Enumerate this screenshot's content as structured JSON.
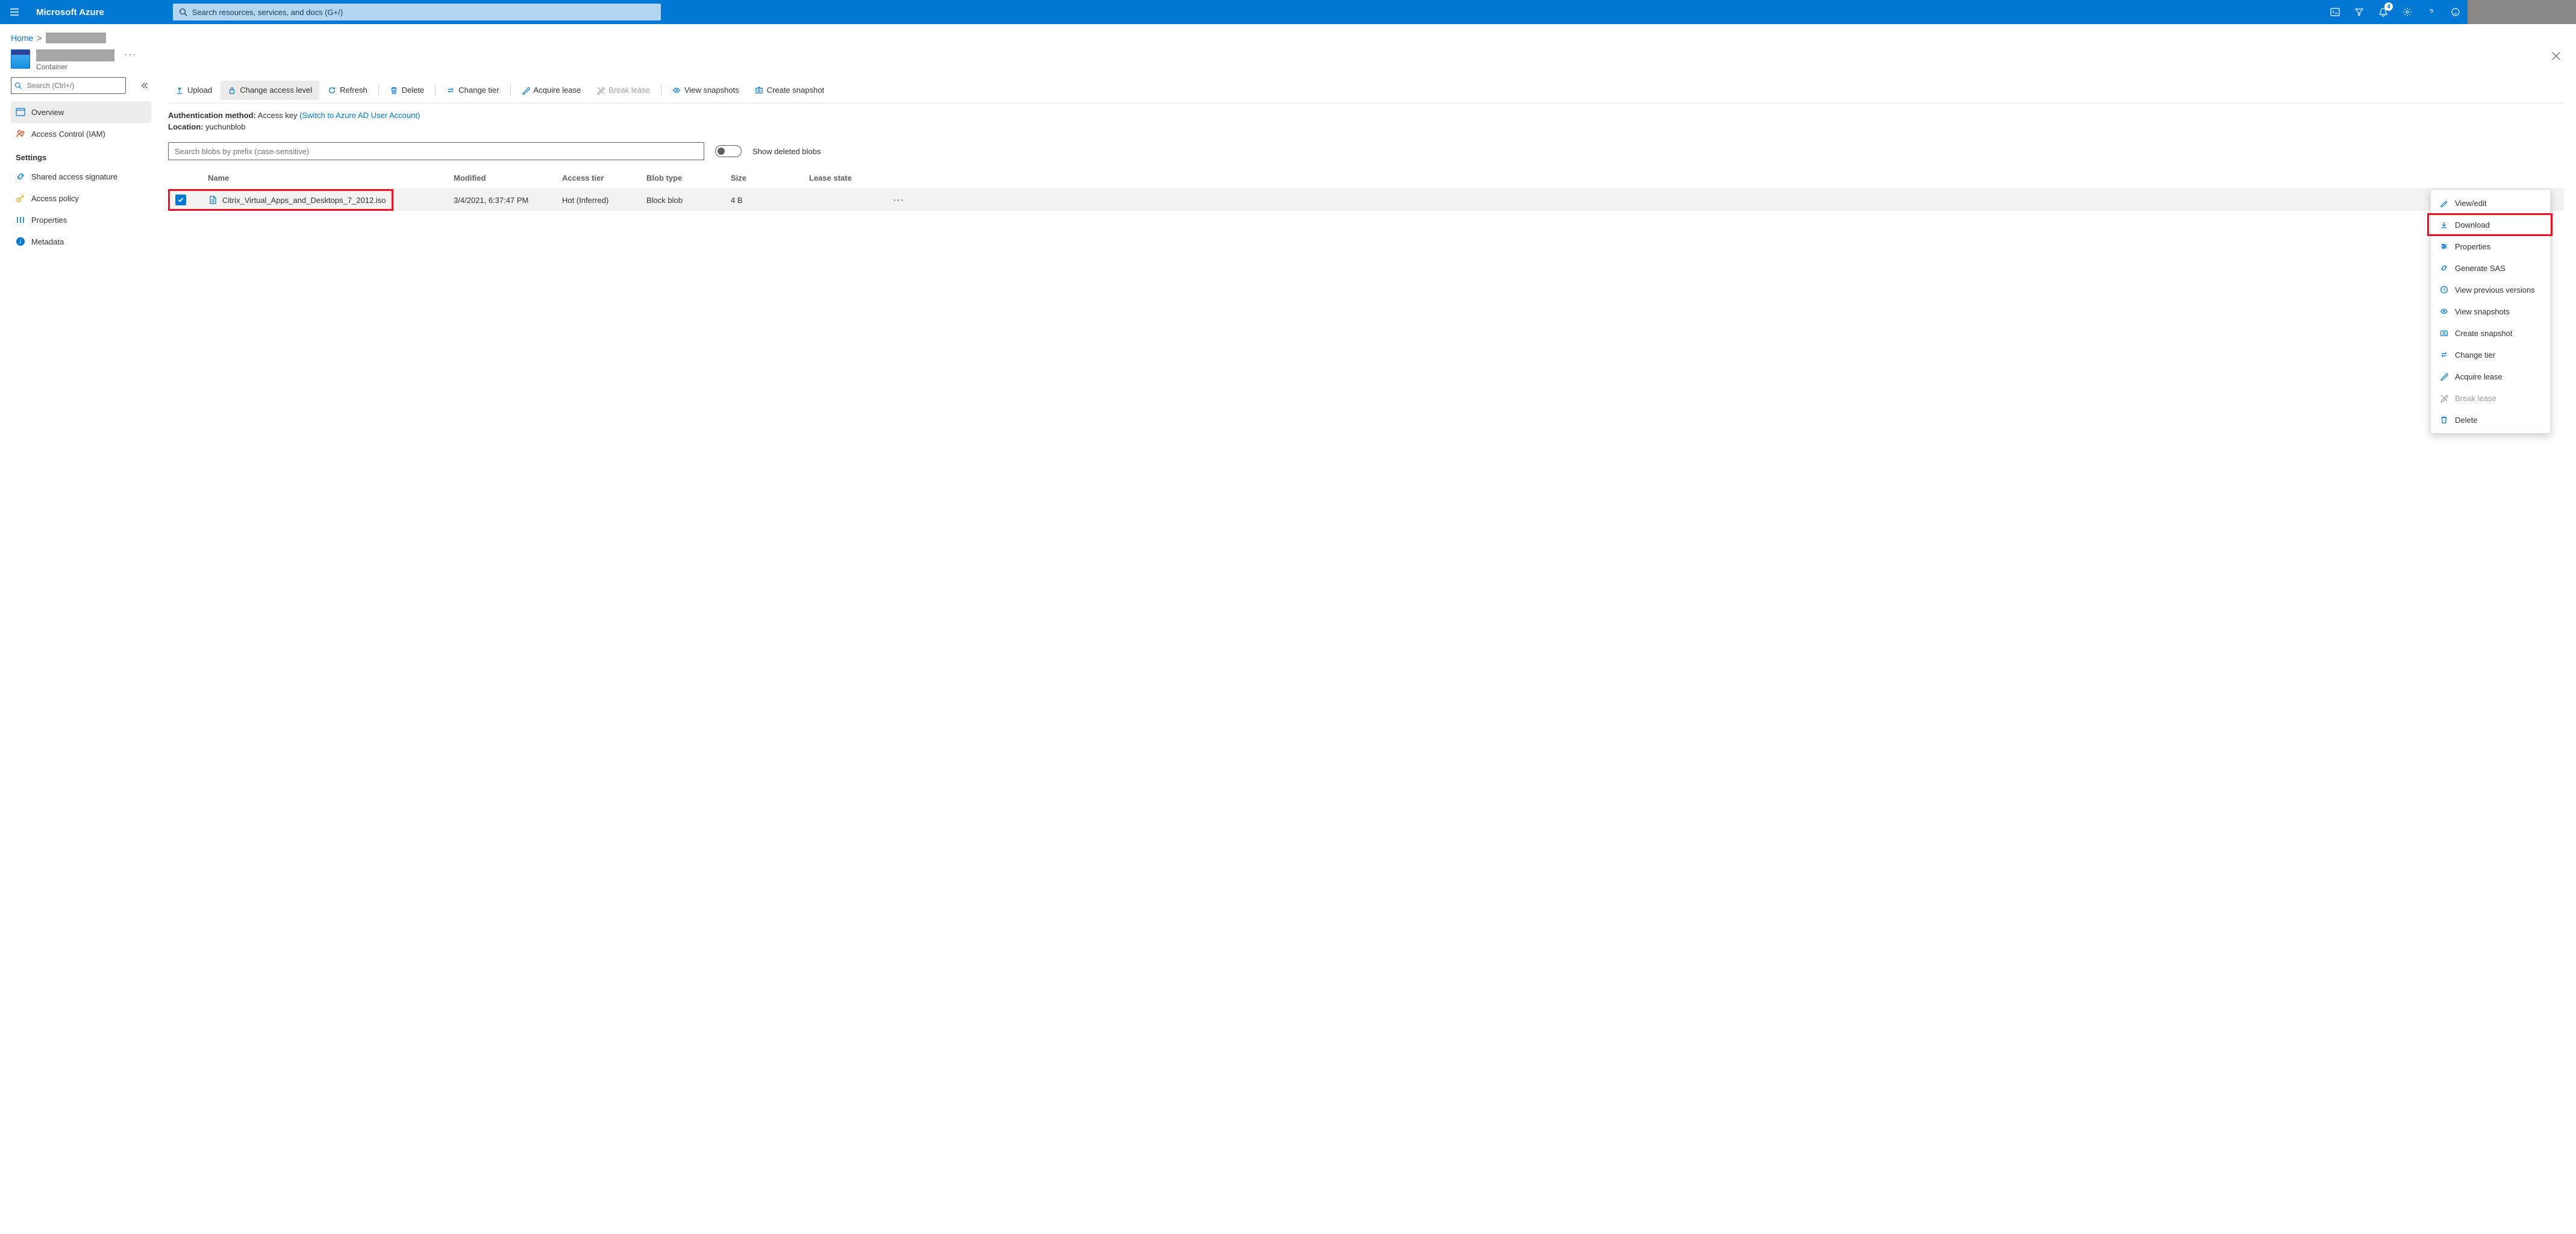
{
  "topbar": {
    "brand": "Microsoft Azure",
    "search_placeholder": "Search resources, services, and docs (G+/)",
    "notification_count": "4"
  },
  "breadcrumb": {
    "home": "Home"
  },
  "resource": {
    "subtitle": "Container"
  },
  "sidebar": {
    "search_placeholder": "Search (Ctrl+/)",
    "items": [
      {
        "label": "Overview"
      },
      {
        "label": "Access Control (IAM)"
      }
    ],
    "settings_header": "Settings",
    "settings": [
      {
        "label": "Shared access signature"
      },
      {
        "label": "Access policy"
      },
      {
        "label": "Properties"
      },
      {
        "label": "Metadata"
      }
    ]
  },
  "toolbar": {
    "upload": "Upload",
    "change_access": "Change access level",
    "refresh": "Refresh",
    "delete": "Delete",
    "change_tier": "Change tier",
    "acquire_lease": "Acquire lease",
    "break_lease": "Break lease",
    "view_snapshots": "View snapshots",
    "create_snapshot": "Create snapshot"
  },
  "info": {
    "auth_label": "Authentication method:",
    "auth_value": "Access key",
    "auth_switch": "(Switch to Azure AD User Account)",
    "location_label": "Location:",
    "location_value": "yuchunblob"
  },
  "blob_search": {
    "placeholder": "Search blobs by prefix (case-sensitive)",
    "toggle_label": "Show deleted blobs"
  },
  "table": {
    "headers": {
      "name": "Name",
      "modified": "Modified",
      "access_tier": "Access tier",
      "blob_type": "Blob type",
      "size": "Size",
      "lease_state": "Lease state"
    },
    "rows": [
      {
        "checked": true,
        "name": "Citrix_Virtual_Apps_and_Desktops_7_2012.iso",
        "modified": "3/4/2021, 6:37:47 PM",
        "access_tier": "Hot (Inferred)",
        "blob_type": "Block blob",
        "size": "4 B",
        "lease_state": ""
      }
    ]
  },
  "context_menu": {
    "items": [
      {
        "label": "View/edit",
        "icon": "pencil",
        "disabled": false
      },
      {
        "label": "Download",
        "icon": "download",
        "disabled": false,
        "highlight": true
      },
      {
        "label": "Properties",
        "icon": "sliders",
        "disabled": false
      },
      {
        "label": "Generate SAS",
        "icon": "link",
        "disabled": false
      },
      {
        "label": "View previous versions",
        "icon": "clock",
        "disabled": false
      },
      {
        "label": "View snapshots",
        "icon": "eye",
        "disabled": false
      },
      {
        "label": "Create snapshot",
        "icon": "snapshot",
        "disabled": false
      },
      {
        "label": "Change tier",
        "icon": "swap",
        "disabled": false
      },
      {
        "label": "Acquire lease",
        "icon": "lease",
        "disabled": false
      },
      {
        "label": "Break lease",
        "icon": "break",
        "disabled": true
      },
      {
        "label": "Delete",
        "icon": "trash",
        "disabled": false
      }
    ]
  }
}
